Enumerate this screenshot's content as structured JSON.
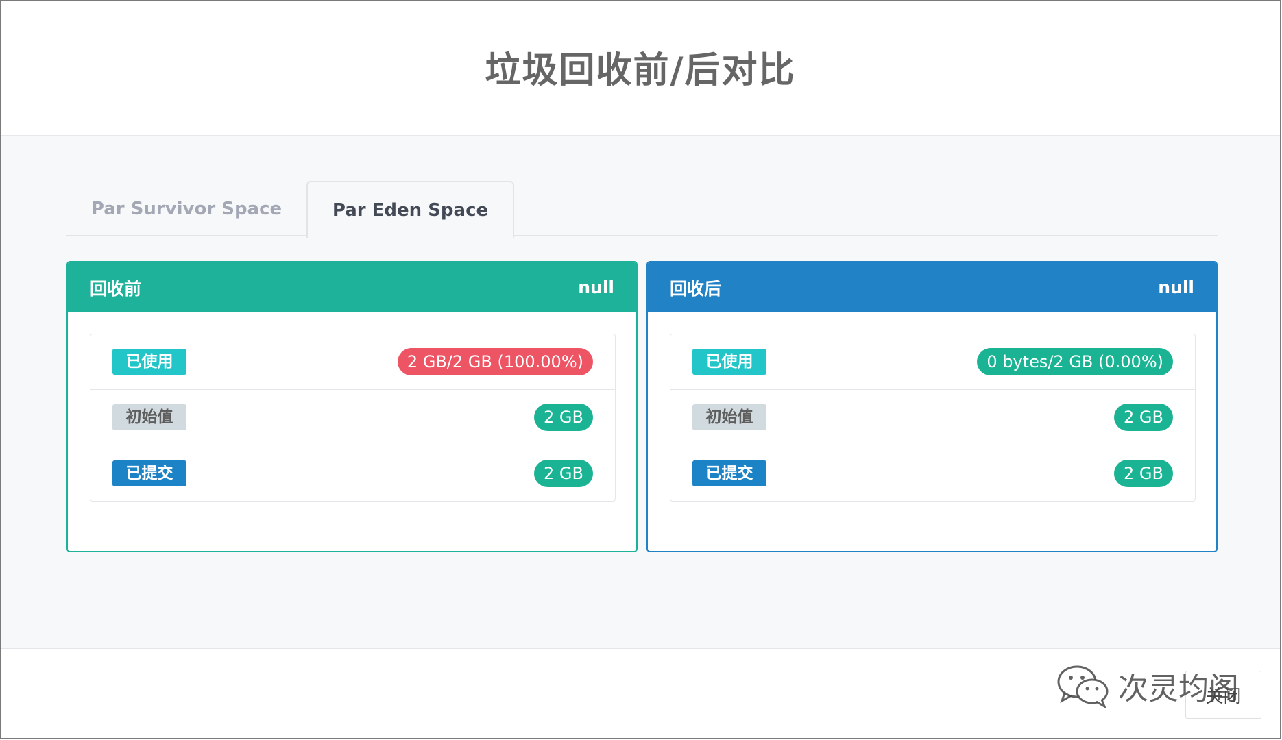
{
  "modal": {
    "title": "垃圾回收前/后对比",
    "close_label": "关闭"
  },
  "tabs": [
    {
      "label": "Par Survivor Space",
      "active": false
    },
    {
      "label": "Par Eden Space",
      "active": true
    }
  ],
  "panels": {
    "before": {
      "title": "回收前",
      "value": "null",
      "color": "#1fb29a",
      "rows": [
        {
          "label": "已使用",
          "value": "2 GB/2 GB (100.00%)"
        },
        {
          "label": "初始值",
          "value": "2 GB"
        },
        {
          "label": "已提交",
          "value": "2 GB"
        }
      ]
    },
    "after": {
      "title": "回收后",
      "value": "null",
      "color": "#2182c6",
      "rows": [
        {
          "label": "已使用",
          "value": "0 bytes/2 GB (0.00%)"
        },
        {
          "label": "初始值",
          "value": "2 GB"
        },
        {
          "label": "已提交",
          "value": "2 GB"
        }
      ]
    }
  },
  "watermark": {
    "text": "次灵均阁",
    "icon": "wechat-icon"
  },
  "colors": {
    "danger": "#ed5565",
    "success": "#1ab394",
    "label_used": "#23c6c8",
    "label_init": "#d1dade",
    "label_commit": "#1c84c6"
  }
}
